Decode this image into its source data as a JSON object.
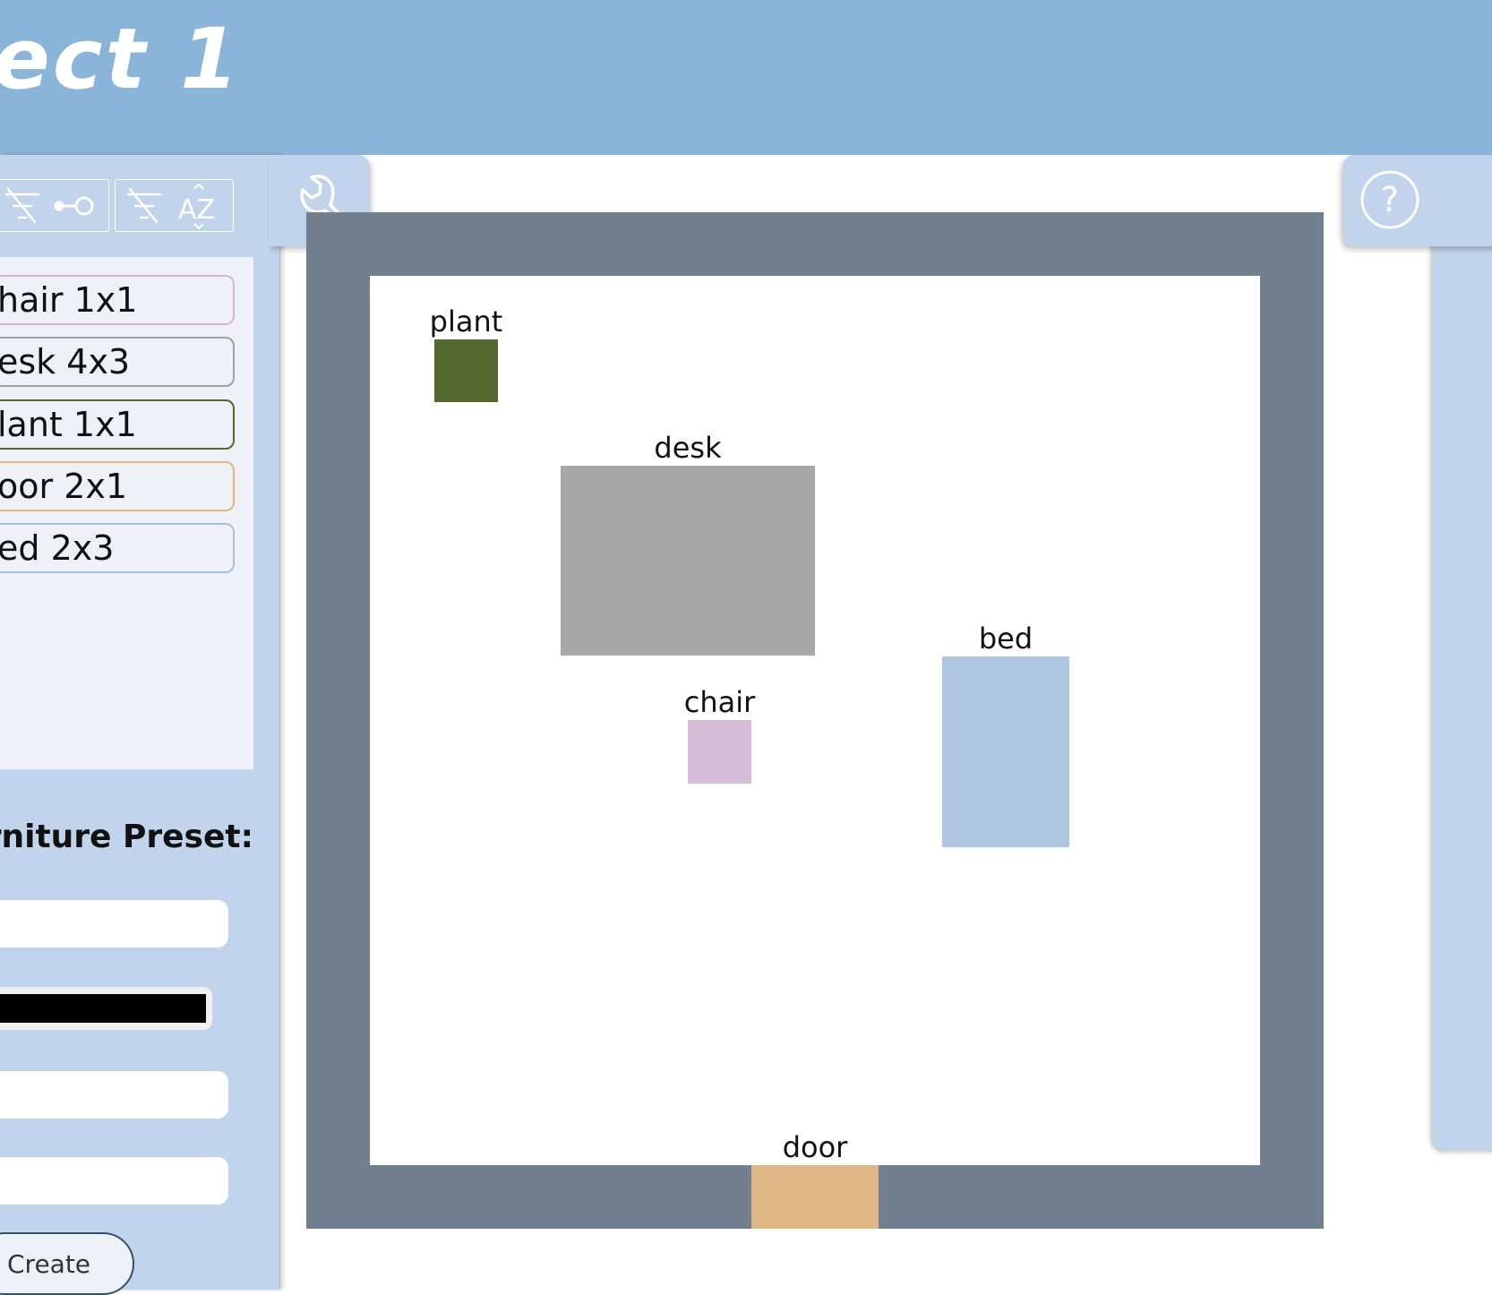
{
  "colors": {
    "header_bg": "#8bb5d8",
    "panel_bg": "#c1d4eb",
    "wall": "#717f8f",
    "floor": "#ffffff"
  },
  "header": {
    "title": "ect 1"
  },
  "toolbar": {
    "tool_icon": "wrench-icon",
    "filter_buttons": [
      {
        "icon": "filter-off-icon",
        "secondary_icon": "key-icon"
      },
      {
        "icon": "filter-off-icon",
        "secondary_icon": "sort-az-icon",
        "secondary_label": "AZ"
      }
    ]
  },
  "furniture_list": [
    {
      "label": "hair 1x1",
      "color": "#d7b4d3"
    },
    {
      "label": "esk 4x3",
      "color": "#a1a1a1"
    },
    {
      "label": "lant 1x1",
      "color": "#556830"
    },
    {
      "label": "oor 2x1",
      "color": "#e3b77b"
    },
    {
      "label": "ed 2x3",
      "color": "#a9bedb"
    }
  ],
  "preset_form": {
    "label": "urniture Preset:",
    "color_value": "#000000",
    "create_label": "Create"
  },
  "help": {
    "icon": "help-icon",
    "glyph": "?"
  },
  "room": {
    "items": [
      {
        "name": "plant",
        "color": "#556830"
      },
      {
        "name": "desk",
        "color": "#a8a8a8"
      },
      {
        "name": "bed",
        "color": "#afc4de"
      },
      {
        "name": "chair",
        "color": "#d7bed8"
      },
      {
        "name": "door",
        "color": "#deb787"
      }
    ]
  }
}
